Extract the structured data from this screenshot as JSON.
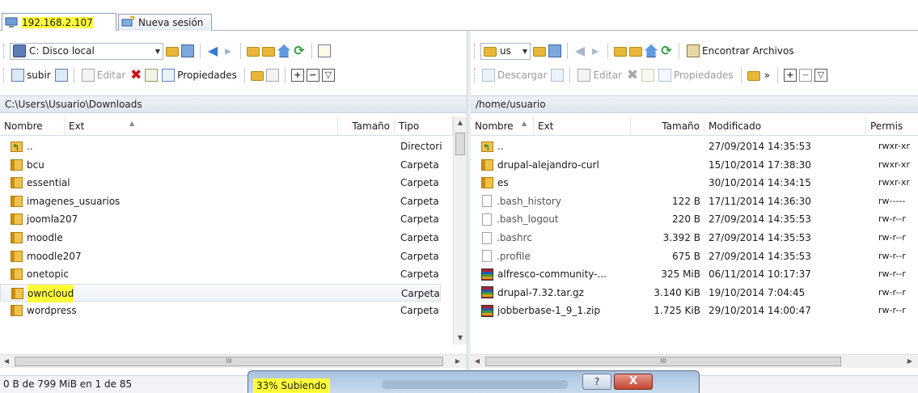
{
  "sessions": {
    "tabs": [
      {
        "label": "192.168.2.107",
        "active": true,
        "icon": "monitor-icon"
      },
      {
        "label": "Nueva sesión",
        "active": false,
        "icon": "new-session-icon"
      }
    ]
  },
  "left": {
    "drive_combo": "C: Disco local",
    "toolbar2": {
      "upload": "subir",
      "edit": "Editar",
      "properties": "Propiedades"
    },
    "path": "C:\\Users\\Usuario\\Downloads",
    "columns": {
      "name": "Nombre",
      "ext": "Ext",
      "size": "Tamaño",
      "type": "Tipo"
    },
    "rows": [
      {
        "name": "..",
        "type": "Directori",
        "kind": "up"
      },
      {
        "name": "bcu",
        "type": "Carpeta",
        "kind": "dir"
      },
      {
        "name": "essential",
        "type": "Carpeta",
        "kind": "dir"
      },
      {
        "name": "imagenes_usuarios",
        "type": "Carpeta",
        "kind": "dir"
      },
      {
        "name": "joomla207",
        "type": "Carpeta",
        "kind": "dir"
      },
      {
        "name": "moodle",
        "type": "Carpeta",
        "kind": "dir"
      },
      {
        "name": "moodle207",
        "type": "Carpeta",
        "kind": "dir"
      },
      {
        "name": "onetopic",
        "type": "Carpeta",
        "kind": "dir"
      },
      {
        "name": "owncloud",
        "type": "Carpeta",
        "kind": "dir",
        "selected": true
      },
      {
        "name": "wordpress",
        "type": "Carpeta",
        "kind": "dir"
      }
    ],
    "hscroll_glyph": "III"
  },
  "right": {
    "dir_combo": "us",
    "find_label": "Encontrar Archivos",
    "toolbar2": {
      "download": "Descargar",
      "edit": "Editar",
      "properties": "Propiedades",
      "more": "»"
    },
    "path": "/home/usuario",
    "columns": {
      "name": "Nombre",
      "ext": "Ext",
      "size": "Tamaño",
      "modified": "Modificado",
      "perms": "Permis"
    },
    "rows": [
      {
        "name": "..",
        "size": "",
        "modified": "27/09/2014 14:35:53",
        "perms": "rwxr-xr",
        "kind": "up"
      },
      {
        "name": "drupal-alejandro-curl",
        "size": "",
        "modified": "15/10/2014 17:38:30",
        "perms": "rwxr-xr",
        "kind": "dir"
      },
      {
        "name": "es",
        "size": "",
        "modified": "30/10/2014 14:34:15",
        "perms": "rwxr-xr",
        "kind": "dir"
      },
      {
        "name": ".bash_history",
        "size": "122 B",
        "modified": "17/11/2014 14:36:30",
        "perms": "rw-----",
        "kind": "file"
      },
      {
        "name": ".bash_logout",
        "size": "220 B",
        "modified": "27/09/2014 14:35:53",
        "perms": "rw-r--r",
        "kind": "file"
      },
      {
        "name": ".bashrc",
        "size": "3.392 B",
        "modified": "27/09/2014 14:35:53",
        "perms": "rw-r--r",
        "kind": "file"
      },
      {
        "name": ".profile",
        "size": "675 B",
        "modified": "27/09/2014 14:35:53",
        "perms": "rw-r--r",
        "kind": "file"
      },
      {
        "name": "alfresco-community-...",
        "size": "325 MiB",
        "modified": "06/11/2014 10:17:37",
        "perms": "rw-r--r",
        "kind": "arch"
      },
      {
        "name": "drupal-7.32.tar.gz",
        "size": "3.140 KiB",
        "modified": "19/10/2014 7:04:45",
        "perms": "rw-r--r",
        "kind": "arch"
      },
      {
        "name": "jobberbase-1_9_1.zip",
        "size": "1.725 KiB",
        "modified": "29/10/2014 14:00:47",
        "perms": "rw-r--r",
        "kind": "arch"
      }
    ],
    "hscroll_glyph": "III"
  },
  "status": {
    "text": "0 B de 799 MiB en 1 de 85"
  },
  "dialog": {
    "title": "33% Subiendo",
    "help": "?",
    "close": "X"
  }
}
